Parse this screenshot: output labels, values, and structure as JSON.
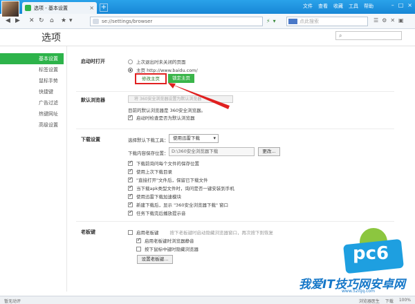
{
  "browser": {
    "tab_title": "选项 - 基本设置",
    "tab_close": "×",
    "new_tab": "+",
    "menus": [
      "文件",
      "查看",
      "收藏",
      "工具",
      "帮助"
    ],
    "window_controls": [
      "–",
      "□",
      "×"
    ],
    "address": "se://settings/browser",
    "search_placeholder": "点此搜索"
  },
  "page": {
    "title": "选项"
  },
  "sidebar": {
    "items": [
      {
        "label": "基本设置",
        "active": true
      },
      {
        "label": "标签设置"
      },
      {
        "label": "鼠标手势"
      },
      {
        "label": "快捷键"
      },
      {
        "label": "广告过滤"
      },
      {
        "label": "热键网址"
      },
      {
        "label": "高级设置"
      }
    ]
  },
  "startup": {
    "label": "启动时打开",
    "option_last": "上次退出时未关闭的页面",
    "option_home": "主页  http://www.baidu.com/",
    "btn_modify_home": "修改主页",
    "btn_lock_home": "锁定主页"
  },
  "default_browser": {
    "label": "默认浏览器",
    "btn_set_default": "将 360安全浏览器设置为默认浏览器",
    "status": "目前的默认浏览器是 360安全浏览器。",
    "check_startup": "启动时检查是否为默认浏览器"
  },
  "download": {
    "label": "下载设置",
    "tool_label": "选择默认下载工具：",
    "tool_value": "使用迅雷下载",
    "path_label": "下载内容保存位置：",
    "path_value": "D:\\360安全浏览器下载",
    "btn_change": "更改...",
    "options": [
      "下载前询问每个文件的保存位置",
      "使用上次下载目录",
      "\"直接打开\"文件后，保留已下载文件",
      "当下载apk类型文件时，询问是否一键安装到手机",
      "使用迅雷下载加速模块",
      "新建下载后，显示 \"360安全浏览器下载\" 窗口",
      "任务下载完后播放提示音"
    ]
  },
  "boss_key": {
    "label": "老板键",
    "enable": "启用老板键",
    "enable_hint": "按下老板键时启动隐藏浏览器窗口，再次按下则恢复",
    "mute": "启用老板键时浏览器静音",
    "middle_click": "按下鼠标中键时隐藏浏览器",
    "btn_set": "设置老板键..."
  },
  "watermark": {
    "badge": "pc6",
    "sub": "我爱IT技巧网",
    "brand": "安卓网",
    "site": "www.52itjq.com"
  },
  "statusbar": {
    "left": "暂无动评",
    "right": [
      "浏览器医生",
      "下载",
      "100%"
    ]
  },
  "colors": {
    "accent_green": "#2db34a",
    "titlebar_blue": "#1787d6",
    "highlight_red": "#e02020"
  }
}
